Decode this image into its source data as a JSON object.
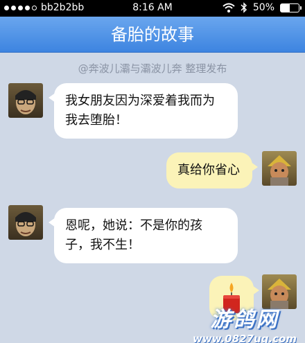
{
  "status_bar": {
    "carrier": "bb2b2bb",
    "time": "8:16 AM",
    "battery": "50%",
    "battery_level": 0.5,
    "signal_icon": "signal-dots-icon",
    "wifi_icon": "wifi-icon",
    "bluetooth_icon": "bluetooth-icon"
  },
  "nav": {
    "title": "备胎的故事"
  },
  "credit": "@奔波儿灞与灞波儿奔 整理发布",
  "messages": [
    {
      "side": "left",
      "text_lines": [
        "我女朋友因为深爱着我而为",
        "我去堕胎！"
      ]
    },
    {
      "side": "right",
      "text_lines": [
        "真给你省心"
      ]
    },
    {
      "side": "left",
      "text_lines": [
        "恩呢，她说：不是你的孩",
        "子，我不生！"
      ]
    },
    {
      "side": "right",
      "icon": "candle-icon"
    }
  ],
  "watermark": {
    "title": "游鸽网",
    "url": "www.0827ug.com"
  }
}
